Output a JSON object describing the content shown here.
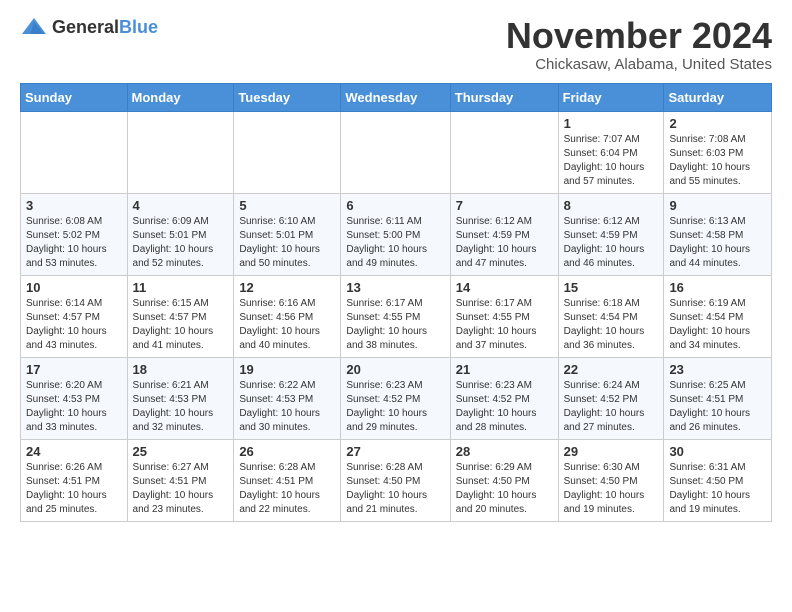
{
  "logo": {
    "general": "General",
    "blue": "Blue"
  },
  "title": "November 2024",
  "location": "Chickasaw, Alabama, United States",
  "headers": [
    "Sunday",
    "Monday",
    "Tuesday",
    "Wednesday",
    "Thursday",
    "Friday",
    "Saturday"
  ],
  "weeks": [
    [
      {
        "day": "",
        "info": ""
      },
      {
        "day": "",
        "info": ""
      },
      {
        "day": "",
        "info": ""
      },
      {
        "day": "",
        "info": ""
      },
      {
        "day": "",
        "info": ""
      },
      {
        "day": "1",
        "info": "Sunrise: 7:07 AM\nSunset: 6:04 PM\nDaylight: 10 hours\nand 57 minutes."
      },
      {
        "day": "2",
        "info": "Sunrise: 7:08 AM\nSunset: 6:03 PM\nDaylight: 10 hours\nand 55 minutes."
      }
    ],
    [
      {
        "day": "3",
        "info": "Sunrise: 6:08 AM\nSunset: 5:02 PM\nDaylight: 10 hours\nand 53 minutes."
      },
      {
        "day": "4",
        "info": "Sunrise: 6:09 AM\nSunset: 5:01 PM\nDaylight: 10 hours\nand 52 minutes."
      },
      {
        "day": "5",
        "info": "Sunrise: 6:10 AM\nSunset: 5:01 PM\nDaylight: 10 hours\nand 50 minutes."
      },
      {
        "day": "6",
        "info": "Sunrise: 6:11 AM\nSunset: 5:00 PM\nDaylight: 10 hours\nand 49 minutes."
      },
      {
        "day": "7",
        "info": "Sunrise: 6:12 AM\nSunset: 4:59 PM\nDaylight: 10 hours\nand 47 minutes."
      },
      {
        "day": "8",
        "info": "Sunrise: 6:12 AM\nSunset: 4:59 PM\nDaylight: 10 hours\nand 46 minutes."
      },
      {
        "day": "9",
        "info": "Sunrise: 6:13 AM\nSunset: 4:58 PM\nDaylight: 10 hours\nand 44 minutes."
      }
    ],
    [
      {
        "day": "10",
        "info": "Sunrise: 6:14 AM\nSunset: 4:57 PM\nDaylight: 10 hours\nand 43 minutes."
      },
      {
        "day": "11",
        "info": "Sunrise: 6:15 AM\nSunset: 4:57 PM\nDaylight: 10 hours\nand 41 minutes."
      },
      {
        "day": "12",
        "info": "Sunrise: 6:16 AM\nSunset: 4:56 PM\nDaylight: 10 hours\nand 40 minutes."
      },
      {
        "day": "13",
        "info": "Sunrise: 6:17 AM\nSunset: 4:55 PM\nDaylight: 10 hours\nand 38 minutes."
      },
      {
        "day": "14",
        "info": "Sunrise: 6:17 AM\nSunset: 4:55 PM\nDaylight: 10 hours\nand 37 minutes."
      },
      {
        "day": "15",
        "info": "Sunrise: 6:18 AM\nSunset: 4:54 PM\nDaylight: 10 hours\nand 36 minutes."
      },
      {
        "day": "16",
        "info": "Sunrise: 6:19 AM\nSunset: 4:54 PM\nDaylight: 10 hours\nand 34 minutes."
      }
    ],
    [
      {
        "day": "17",
        "info": "Sunrise: 6:20 AM\nSunset: 4:53 PM\nDaylight: 10 hours\nand 33 minutes."
      },
      {
        "day": "18",
        "info": "Sunrise: 6:21 AM\nSunset: 4:53 PM\nDaylight: 10 hours\nand 32 minutes."
      },
      {
        "day": "19",
        "info": "Sunrise: 6:22 AM\nSunset: 4:53 PM\nDaylight: 10 hours\nand 30 minutes."
      },
      {
        "day": "20",
        "info": "Sunrise: 6:23 AM\nSunset: 4:52 PM\nDaylight: 10 hours\nand 29 minutes."
      },
      {
        "day": "21",
        "info": "Sunrise: 6:23 AM\nSunset: 4:52 PM\nDaylight: 10 hours\nand 28 minutes."
      },
      {
        "day": "22",
        "info": "Sunrise: 6:24 AM\nSunset: 4:52 PM\nDaylight: 10 hours\nand 27 minutes."
      },
      {
        "day": "23",
        "info": "Sunrise: 6:25 AM\nSunset: 4:51 PM\nDaylight: 10 hours\nand 26 minutes."
      }
    ],
    [
      {
        "day": "24",
        "info": "Sunrise: 6:26 AM\nSunset: 4:51 PM\nDaylight: 10 hours\nand 25 minutes."
      },
      {
        "day": "25",
        "info": "Sunrise: 6:27 AM\nSunset: 4:51 PM\nDaylight: 10 hours\nand 23 minutes."
      },
      {
        "day": "26",
        "info": "Sunrise: 6:28 AM\nSunset: 4:51 PM\nDaylight: 10 hours\nand 22 minutes."
      },
      {
        "day": "27",
        "info": "Sunrise: 6:28 AM\nSunset: 4:50 PM\nDaylight: 10 hours\nand 21 minutes."
      },
      {
        "day": "28",
        "info": "Sunrise: 6:29 AM\nSunset: 4:50 PM\nDaylight: 10 hours\nand 20 minutes."
      },
      {
        "day": "29",
        "info": "Sunrise: 6:30 AM\nSunset: 4:50 PM\nDaylight: 10 hours\nand 19 minutes."
      },
      {
        "day": "30",
        "info": "Sunrise: 6:31 AM\nSunset: 4:50 PM\nDaylight: 10 hours\nand 19 minutes."
      }
    ]
  ]
}
